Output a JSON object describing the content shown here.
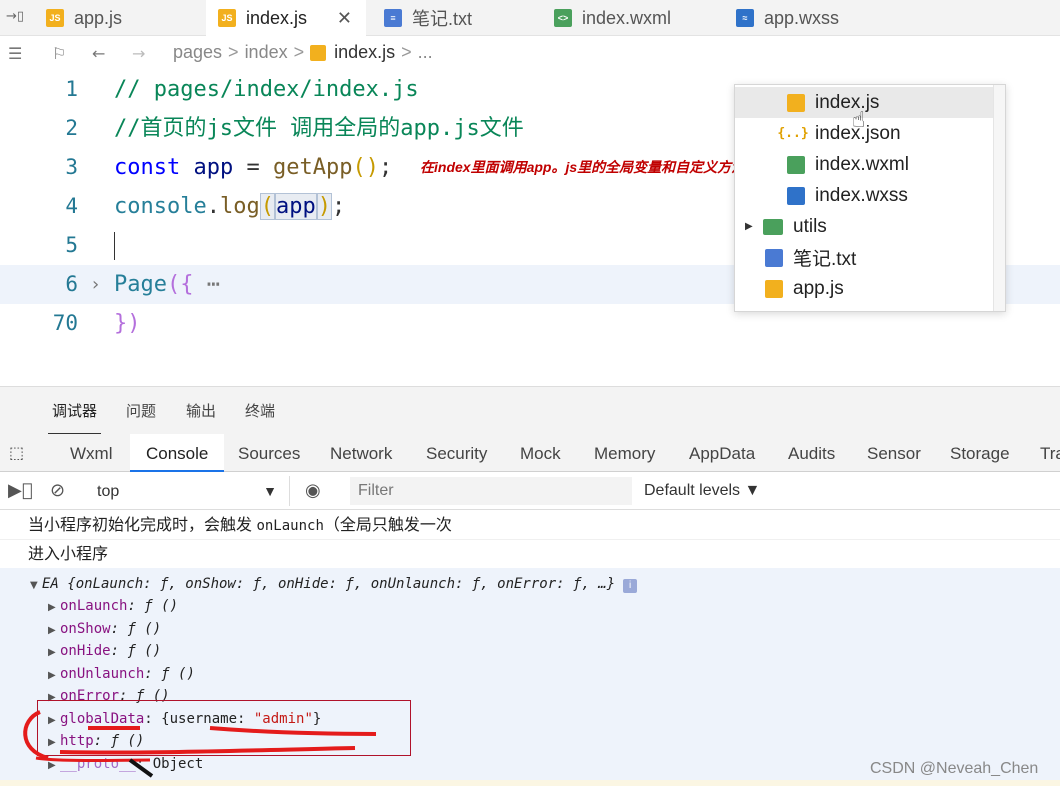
{
  "tabs": [
    {
      "label": "app.js",
      "icon": "js-file-icon",
      "type": "js"
    },
    {
      "label": "index.js",
      "icon": "js-file-icon",
      "type": "js",
      "active": true
    },
    {
      "label": "笔记.txt",
      "icon": "txt-file-icon",
      "type": "txt"
    },
    {
      "label": "index.wxml",
      "icon": "wxml-file-icon",
      "type": "wxml"
    },
    {
      "label": "app.wxss",
      "icon": "wxss-file-icon",
      "type": "wxss"
    }
  ],
  "close_glyph": "✕",
  "breadcrumb": {
    "items": [
      "pages",
      "index",
      "index.js",
      "..."
    ],
    "sep": ">"
  },
  "editor": {
    "line_numbers": [
      "1",
      "2",
      "3",
      "4",
      "5",
      "6",
      "70"
    ],
    "line1": "// pages/index/index.js",
    "line2": "//首页的js文件 调用全局的app.js文件",
    "line3_kw": "const",
    "line3_var": "app",
    "line3_eq": "=",
    "line3_fn": "getApp",
    "line3_paren": "()",
    "line3_semi": ";",
    "line3_note": "在index里面调用app。js里的全局变量和自定义方法",
    "line4_obj": "console",
    "line4_dot": ".",
    "line4_fn": "log",
    "line4_open": "(",
    "line4_arg": "app",
    "line4_close": ")",
    "line4_semi": ";",
    "line6_fn": "Page",
    "line6_open": "({",
    "line6_ellipsis": "⋯",
    "line70_close": "})",
    "fold_glyph": "›"
  },
  "file_tree": {
    "items": [
      {
        "label": "index.js",
        "icon": "js-file-icon"
      },
      {
        "label": "index.json",
        "icon": "json-file-icon"
      },
      {
        "label": "index.wxml",
        "icon": "wxml-file-icon"
      },
      {
        "label": "index.wxss",
        "icon": "wxss-file-icon"
      },
      {
        "label": "utils",
        "icon": "folder-icon"
      },
      {
        "label": "笔记.txt",
        "icon": "txt-file-icon"
      },
      {
        "label": "app.js",
        "icon": "js-file-icon"
      }
    ],
    "json_glyph": "{..}"
  },
  "devtools": {
    "top_tabs": [
      "调试器",
      "问题",
      "输出",
      "终端"
    ],
    "panel_tabs": [
      "Wxml",
      "Console",
      "Sources",
      "Network",
      "Security",
      "Mock",
      "Memory",
      "AppData",
      "Audits",
      "Sensor",
      "Storage",
      "Tra"
    ],
    "context": "top",
    "filter_placeholder": "Filter",
    "levels": "Default levels ▼"
  },
  "console": {
    "log1_prefix": "当小程序初始化完成时，会触发 ",
    "log1_code": "onLaunch",
    "log1_suffix": "（全局只触发一次",
    "log2": "进入小程序",
    "object_header": "EA {onLaunch: ƒ, onShow: ƒ, onHide: ƒ, onUnlaunch: ƒ, onError: ƒ, …}",
    "info_badge": "i",
    "properties": [
      {
        "key": "onLaunch",
        "value": ": ƒ ()"
      },
      {
        "key": "onShow",
        "value": ": ƒ ()"
      },
      {
        "key": "onHide",
        "value": ": ƒ ()"
      },
      {
        "key": "onUnlaunch",
        "value": ": ƒ ()"
      },
      {
        "key": "onError",
        "value": ": ƒ ()"
      },
      {
        "key": "globalData",
        "value": ": {username: ",
        "string": "\"admin\"",
        "tail": "}"
      },
      {
        "key": "http",
        "value": ": ƒ ()"
      },
      {
        "key": "__proto__",
        "value": ": Object"
      }
    ]
  },
  "watermark": "CSDN @Neveah_Chen",
  "colors": {
    "accent": "#1a73e8",
    "annotation_red": "#e41b1b",
    "note_red": "#c00000",
    "js_icon": "#f2b01e",
    "wxml_icon": "#4aa05c",
    "wxss_icon": "#2f72c9"
  }
}
